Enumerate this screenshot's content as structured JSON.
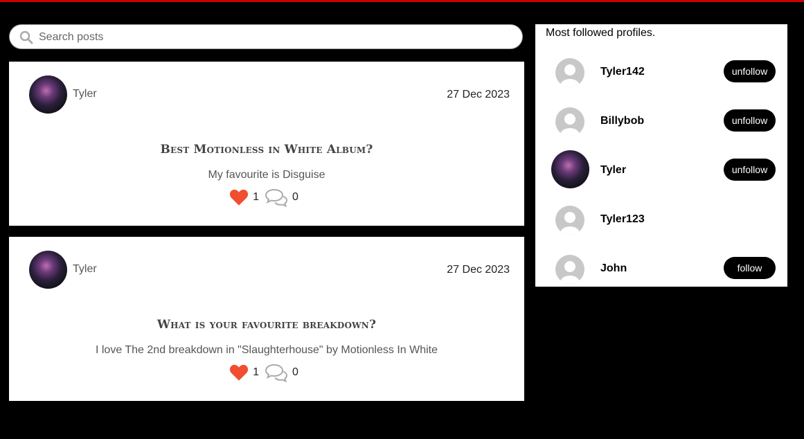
{
  "search": {
    "placeholder": "Search posts"
  },
  "posts": [
    {
      "author": "Tyler",
      "date": "27 Dec 2023",
      "title": "Best Motionless in White Album?",
      "body": "My favourite is Disguise",
      "likes": "1",
      "comments": "0"
    },
    {
      "author": "Tyler",
      "date": "27 Dec 2023",
      "title": "What is your favourite breakdown?",
      "body": "I love The 2nd breakdown in \"Slaughterhouse\" by Motionless In White",
      "likes": "1",
      "comments": "0"
    }
  ],
  "sidebar": {
    "heading": "Most followed profiles.",
    "profiles": [
      {
        "name": "Tyler142",
        "button": "unfollow",
        "avatar": "default-avatar"
      },
      {
        "name": "Billybob",
        "button": "unfollow",
        "avatar": "default-avatar"
      },
      {
        "name": "Tyler",
        "button": "unfollow",
        "avatar": "photo-avatar"
      },
      {
        "name": "Tyler123",
        "button": "",
        "avatar": "default-avatar"
      },
      {
        "name": "John",
        "button": "follow",
        "avatar": "default-avatar"
      }
    ]
  },
  "colors": {
    "accent_bar": "#cc0000",
    "heart": "#f04e2f",
    "button_bg": "#000000"
  }
}
